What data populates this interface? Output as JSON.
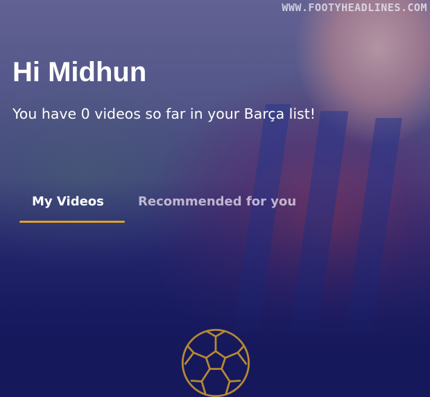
{
  "watermark": "WWW.FOOTYHEADLINES.COM",
  "greeting": "Hi Midhun",
  "subtitle": "You have 0 videos so far in your Barça list!",
  "tabs": [
    {
      "label": "My Videos",
      "active": true
    },
    {
      "label": "Recommended for you",
      "active": false
    }
  ],
  "empty_state": {
    "icon": "soccer-ball-icon"
  },
  "colors": {
    "background": "#16185c",
    "accent": "#e0a12a",
    "text": "#ffffff"
  }
}
